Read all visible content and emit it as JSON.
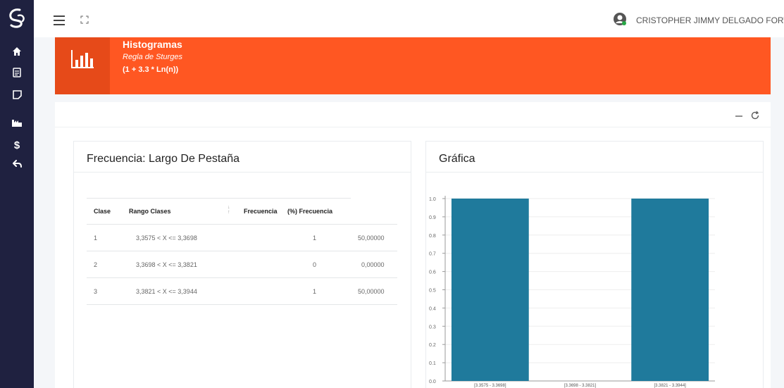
{
  "sidebar": {
    "logo": "cs-logo",
    "items": [
      {
        "icon": "home-icon"
      },
      {
        "icon": "document-icon"
      },
      {
        "icon": "note-icon"
      },
      {
        "icon": "factory-icon"
      },
      {
        "icon": "dollar-icon"
      },
      {
        "icon": "back-arrow-icon"
      }
    ]
  },
  "header": {
    "user_name": "CRISTOPHER JIMMY DELGADO FORTTY"
  },
  "banner": {
    "title": "Histogramas",
    "subtitle": "Regla de Sturges",
    "formula": "(1 + 3.3 * Ln(n))",
    "color": "#ff5722"
  },
  "frequency_panel": {
    "title": "Frecuencia: Largo De Pestaña",
    "columns": [
      "Clase",
      "Rango Clases",
      "Frecuencia",
      "(%) Frecuencia"
    ],
    "rows": [
      {
        "clase": "1",
        "rango": "3,3575 < X <= 3,3698",
        "frecuencia": "1",
        "porcentaje": "50,00000"
      },
      {
        "clase": "2",
        "rango": "3,3698 < X <= 3,3821",
        "frecuencia": "0",
        "porcentaje": "0,00000"
      },
      {
        "clase": "3",
        "rango": "3,3821 < X <= 3,3944",
        "frecuencia": "1",
        "porcentaje": "50,00000"
      }
    ]
  },
  "chart_panel": {
    "title": "Gráfica"
  },
  "chart_data": {
    "type": "bar",
    "categories": [
      "[3.3575 - 3.3698]",
      "[3.3698 - 3.3821]",
      "[3.3821 - 3.3944]"
    ],
    "values": [
      1,
      0,
      1
    ],
    "ylim": [
      0,
      1.0
    ],
    "yticks": [
      "0.0",
      "0.1",
      "0.2",
      "0.3",
      "0.4",
      "0.5",
      "0.6",
      "0.7",
      "0.8",
      "0.9",
      "1.0"
    ],
    "bar_color": "#1f7a9c",
    "grid": true
  }
}
